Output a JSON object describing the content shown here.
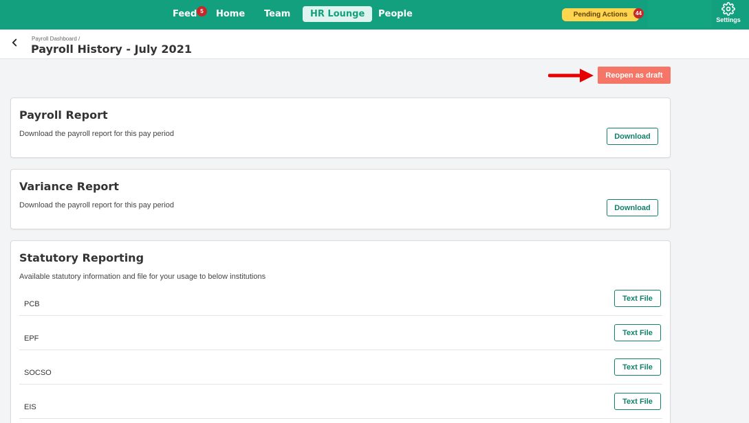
{
  "nav": {
    "items": [
      {
        "label": "Feed",
        "badge": "5"
      },
      {
        "label": "Home"
      },
      {
        "label": "Team"
      },
      {
        "label": "HR Lounge",
        "active": true
      },
      {
        "label": "People"
      }
    ],
    "pending_label": "Pending Actions",
    "pending_count": "44",
    "settings_label": "Settings",
    "settings_icon": "gear-icon",
    "accent_color": "#13a07e"
  },
  "header": {
    "breadcrumb": "Payroll Dashboard /",
    "title": "Payroll History - July 2021",
    "back_icon": "chevron-left-icon"
  },
  "actions": {
    "reopen_label": "Reopen as draft",
    "reopen_color": "#f57666",
    "annotation_arrow_color": "#e60000"
  },
  "payroll_report": {
    "title": "Payroll Report",
    "description": "Download the payroll report for this pay period",
    "button": "Download"
  },
  "variance_report": {
    "title": "Variance Report",
    "description": "Download the payroll report for this pay period",
    "button": "Download"
  },
  "statutory": {
    "title": "Statutory Reporting",
    "description": "Available statutory information and file for your usage to below institutions",
    "rows": [
      {
        "label": "PCB",
        "button": "Text File"
      },
      {
        "label": "EPF",
        "button": "Text File"
      },
      {
        "label": "SOCSO",
        "button": "Text File"
      },
      {
        "label": "EIS",
        "button": "Text File"
      }
    ]
  }
}
